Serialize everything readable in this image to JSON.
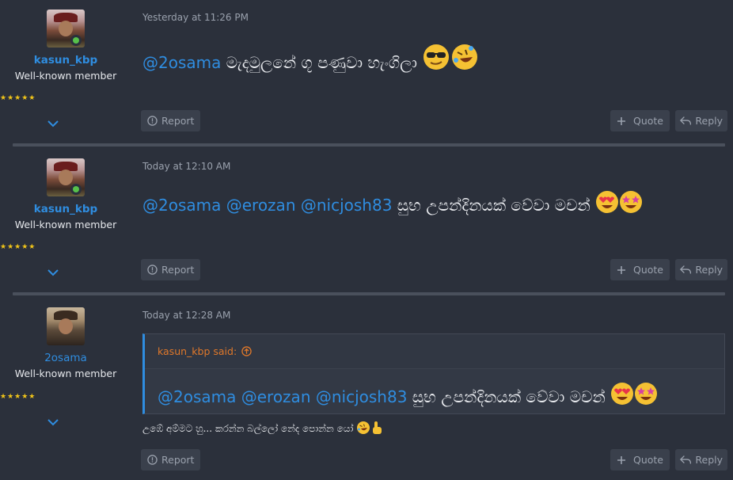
{
  "posts": [
    {
      "author": "kasun_kbp",
      "user_title": "Well-known member",
      "stars": "★★★★★",
      "time": "Yesterday at 11:26 PM",
      "mention": "@2osama",
      "text": "මැදමුලනේ ගූ පණුවා හැංගිලා",
      "emojis": [
        "sunglasses-face",
        "rolling-laughing-face"
      ],
      "report": "Report",
      "quote": "Quote",
      "reply": "Reply"
    },
    {
      "author": "kasun_kbp",
      "user_title": "Well-known member",
      "stars": "★★★★★",
      "time": "Today at 12:10 AM",
      "mentions": [
        "@2osama",
        "@erozan",
        "@nicjosh83"
      ],
      "text": "සුභ උපන්දිනයක් වේවා මචන්",
      "emojis": [
        "heart-eyes-face",
        "star-struck-face"
      ],
      "report": "Report",
      "quote": "Quote",
      "reply": "Reply"
    },
    {
      "author": "2osama",
      "user_title": "Well-known member",
      "stars": "★★★★★",
      "time": "Today at 12:28 AM",
      "quote_block": {
        "said": "kasun_kbp said:",
        "mentions": [
          "@2osama",
          "@erozan",
          "@nicjosh83"
        ],
        "text": "සුභ උපන්දිනයක් වේවා මචන්"
      },
      "text": "උඹේ අම්මට හු... කරන්න බල්ලෝ නේද පොන්න යෝ",
      "emojis": [
        "rolling-laughing-face",
        "pointing-up-hand"
      ],
      "report": "Report",
      "quote": "Quote",
      "reply": "Reply"
    }
  ],
  "colors": {
    "background": "#2b303b",
    "link": "#2f8de0",
    "quote_author": "#e0782a",
    "star": "#f0c419"
  }
}
